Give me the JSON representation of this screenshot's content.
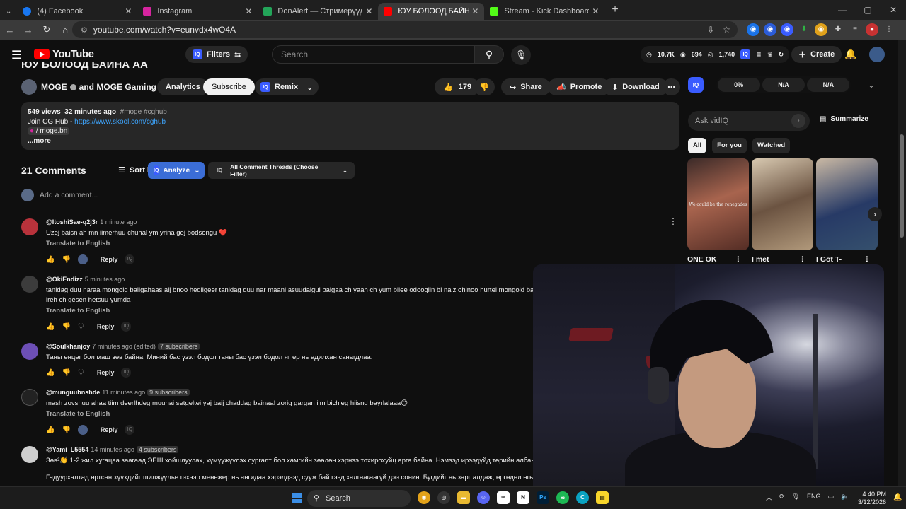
{
  "browser": {
    "tabs": [
      {
        "title": "(4) Facebook",
        "color": "#1877f2"
      },
      {
        "title": "Instagram",
        "color": "#d6249f"
      },
      {
        "title": "DonAlert — Стримерүүдэд зор",
        "color": "#23a559"
      },
      {
        "title": "ЮУ БОЛООД БАЙНА АА - You",
        "color": "#ff0000"
      },
      {
        "title": "Stream - Kick Dashboard",
        "color": "#53fc18"
      }
    ],
    "url": "youtube.com/watch?v=eunvdx4wO4A"
  },
  "yt_header": {
    "logo": "YouTube",
    "filters_label": "Filters",
    "search_placeholder": "Search",
    "stats": {
      "s1": "10.7K",
      "s2": "694",
      "s3": "1,740"
    },
    "create_label": "Create"
  },
  "video": {
    "title": "ЮУ БОЛООД БАЙНА АА",
    "channel": "MOGE",
    "channel_and": "and MOGE Gaming",
    "analytics_label": "Analytics",
    "subscribe_label": "Subscribe",
    "remix_label": "Remix",
    "likes": "179",
    "share_label": "Share",
    "promote_label": "Promote",
    "download_label": "Download"
  },
  "description": {
    "views": "549 views",
    "time": "32 minutes ago",
    "tags": "#moge #cghub",
    "join_text": "Join CG Hub - ",
    "join_link": "https://www.skool.com/cghub",
    "ig": " / moge.bn",
    "more": "...more"
  },
  "comments_bar": {
    "count": "21 Comments",
    "sort": "Sort by",
    "analyze": "Analyze",
    "threads": "All Comment Threads (Choose Filter)",
    "add_placeholder": "Add a comment..."
  },
  "comments": [
    {
      "handle": "@ItoshiSae-q2j3r",
      "time": "1 minute ago",
      "subs": "",
      "text": "Uzej baisn ah mn iimerhuu chuhal ym yrina gej bodsongu ❤️",
      "text2": "",
      "translate": "Translate to English",
      "reply": "Reply",
      "avatar_color": "#b8323b"
    },
    {
      "handle": "@OkiEndizz",
      "time": "5 minutes ago",
      "subs": "",
      "text": "tanidag duu naraa mongold bailgahaas aij bnoo hediigeer tanidag duu nar maani asuudalgui baigaa ch yaah ch yum bilee odoogiin bi naiz ohinoo hurtel mongold bailg",
      "text2": "ireh ch gesen hetsuu yumda",
      "translate": "Translate to English",
      "reply": "Reply",
      "avatar_color": "#3c3c3c"
    },
    {
      "handle": "@Soulkhanjoy",
      "time": "7 minutes ago (edited)",
      "subs": "7 subscribers",
      "text": "Таны өнцөг бол маш зөв байна. Миний бас үзэл бодол таны бас үзэл бодол яг ер нь адилхан санагдлаа.",
      "text2": "",
      "translate": "",
      "reply": "Reply",
      "avatar_color": "#6d4fb6"
    },
    {
      "handle": "@munguubnshde",
      "time": "11 minutes ago",
      "subs": "9 subscribers",
      "text": "mash zovshuu ahaa tiim deerlhdeg muuhai setgeltei yaj baij chaddag bainaa! zorig gargan iim bichleg hiisnd bayrlalaaa😊",
      "text2": "",
      "translate": "Translate to English",
      "reply": "Reply",
      "avatar_color": "#222222"
    },
    {
      "handle": "@Yami_L5554",
      "time": "14 minutes ago",
      "subs": "4 subscribers",
      "text": "Зөв²👏 1-2 жил хугацаа заагаад ЭЕШ хойшлуулах, хүмүүжүүлэх сургалт бол хамгийн зөөлөн хэрнээ тохирохуйц арга байна. Нэмээд ирээдүйд төрийн албан",
      "text2": "Гадуурхалтад өртсөн хүүхдийг шилжүүлье гэхээр менежер нь ангидаа хэрэлдээд сууж бай гээд халгаагаагүй дээ сонин. Бугдийг нь зарг алдаж, өргөдөл өгье",
      "translate": "",
      "reply": "Reply",
      "avatar_color": "#cfcfcf"
    }
  ],
  "sidebar": {
    "vidiq_values": [
      "0%",
      "N/A",
      "N/A"
    ],
    "ask_placeholder": "Ask vidIQ",
    "summarize": "Summarize",
    "chips": [
      "All",
      "For you",
      "Watched"
    ],
    "thumb1_overlay": "We could be the renegades",
    "video_titles": [
      "ONE OK",
      "I met",
      "I Got T-"
    ]
  },
  "taskbar": {
    "search": "Search",
    "lang": "ENG",
    "time": "4:40 PM",
    "date": "3/12/2026"
  }
}
